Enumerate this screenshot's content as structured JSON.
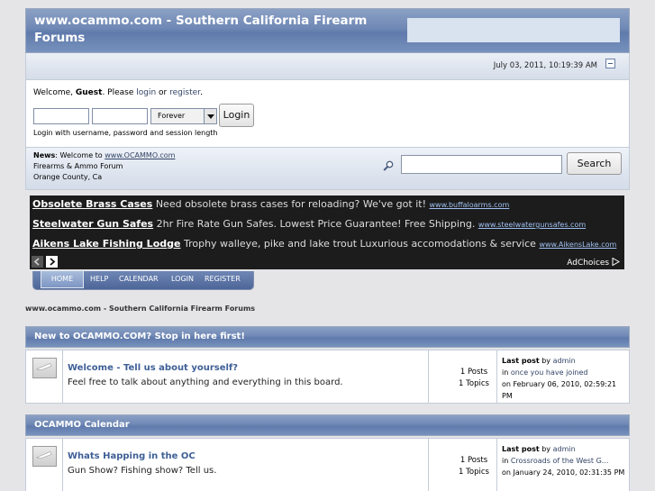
{
  "header": {
    "title": "www.ocammo.com - Southern California Firearm Forums",
    "date": "July 03, 2011, 10:19:39 AM"
  },
  "login_panel": {
    "welcome_prefix": "Welcome, ",
    "guest": "Guest",
    "please": ". Please ",
    "login_link": "login",
    "or": " or ",
    "register_link": "register",
    "period": ".",
    "duration": "Forever",
    "login_button": "Login",
    "hint": "Login with username, password and session length"
  },
  "news": {
    "label": "News",
    "text_prefix": ": Welcome to ",
    "link": "www.OCAMMO.com",
    "line2": "Firearms & Ammo Forum",
    "line3": "Orange County, Ca",
    "search_button": "Search"
  },
  "ads": {
    "items": [
      {
        "title": "Obsolete Brass Cases",
        "text": "Need obsolete brass cases for reloading? We've got it!",
        "url": "www.buffaloarms.com"
      },
      {
        "title": "Steelwater Gun Safes",
        "text": "2hr Fire Rate Gun Safes. Lowest Price Guarantee! Free Shipping.",
        "url": "www.steelwatergunsafes.com"
      },
      {
        "title": "Aikens Lake Fishing Lodge",
        "text": "Trophy walleye, pike and lake trout Luxurious accomodations & service",
        "url": "www.AikensLake.com"
      }
    ],
    "adchoices": "AdChoices"
  },
  "menu": [
    "HOME",
    "HELP",
    "CALENDAR",
    "LOGIN",
    "REGISTER"
  ],
  "breadcrumb": "www.ocammo.com - Southern California Firearm Forums",
  "categories": [
    {
      "title": "New to OCAMMO.COM? Stop in here first!",
      "board": {
        "name": "Welcome - Tell us about yourself?",
        "desc": "Feel free to talk about anything and everything in this board.",
        "posts": "1 Posts",
        "topics": "1 Topics",
        "lastpost_label": "Last post",
        "by": " by ",
        "author": "admin",
        "in": "in ",
        "topic": "once you have joined",
        "on": "on February 06, 2010, 02:59:21 PM"
      }
    },
    {
      "title": "OCAMMO Calendar",
      "board": {
        "name": "Whats Happing in the OC",
        "desc": "Gun Show? Fishing show? Tell us.",
        "posts": "1 Posts",
        "topics": "1 Topics",
        "lastpost_label": "Last post",
        "by": " by ",
        "author": "admin",
        "in": "in ",
        "topic": "Crossroads of the West G...",
        "on": "on January 24, 2010, 02:31:35 PM"
      }
    }
  ]
}
